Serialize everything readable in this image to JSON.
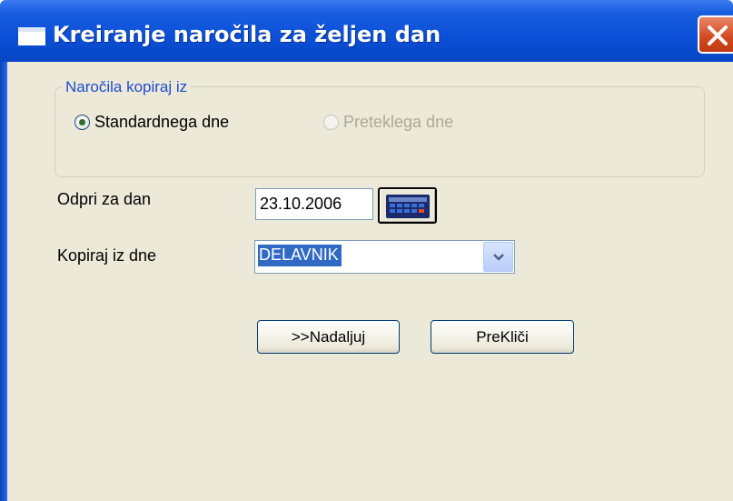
{
  "window": {
    "title": "Kreiranje naročila za željen dan"
  },
  "group": {
    "legend": "Naročila kopiraj iz",
    "options": [
      {
        "label": "Standardnega dne",
        "checked": true,
        "enabled": true
      },
      {
        "label": "Preteklega dne",
        "checked": false,
        "enabled": false
      }
    ]
  },
  "form": {
    "open_day_label": "Odpri za dan",
    "open_day_value": "23.10.2006",
    "copy_from_label": "Kopiraj iz dne",
    "copy_from_value": "DELAVNIK"
  },
  "buttons": {
    "continue_label": ">>Nadaljuj",
    "cancel_label": "PreKliči"
  },
  "icons": {
    "title": "window-icon",
    "close": "close-icon",
    "calendar": "calendar-icon",
    "dropdown": "chevron-down-icon"
  },
  "colors": {
    "titlebar": "#0a4fd6",
    "client_bg": "#ece9d8",
    "selection": "#316ac5",
    "legend": "#1f4ccf"
  }
}
